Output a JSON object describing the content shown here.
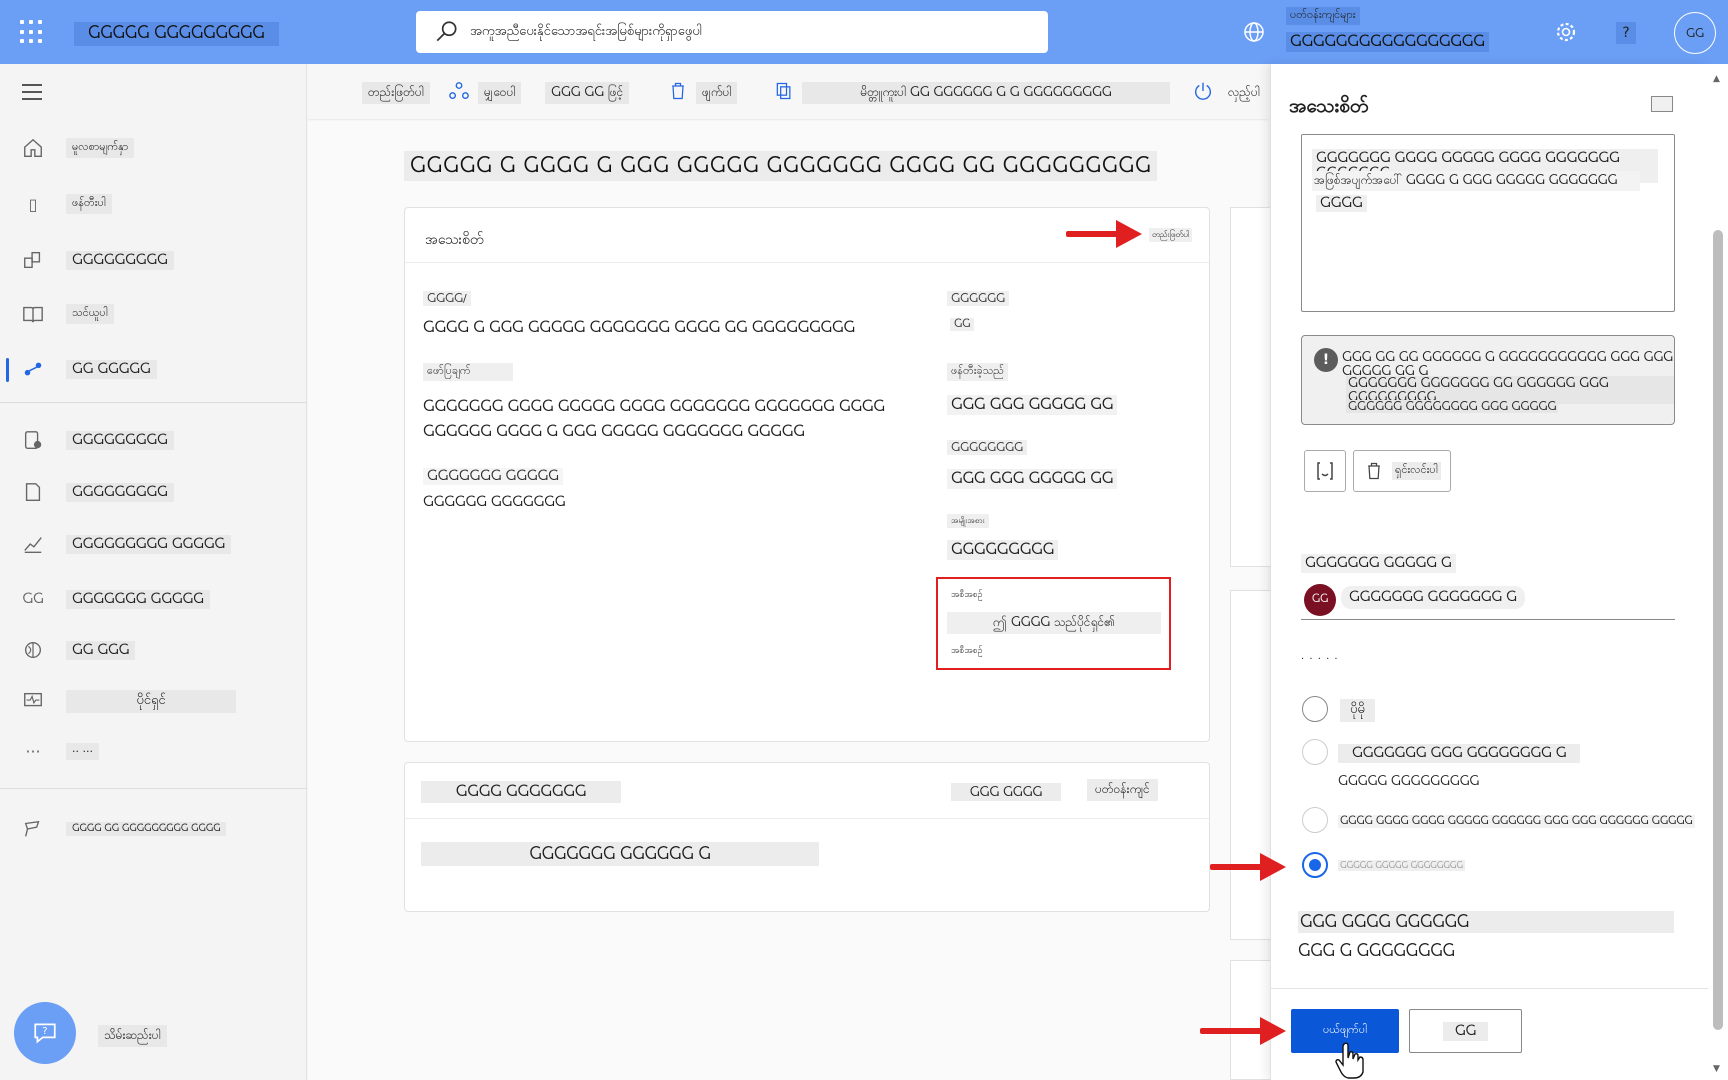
{
  "topbar": {
    "app_title": "ႺႺႺႺႺ ႺႺႺႺႺႺႺႺႺ",
    "search_placeholder": "အကူအညီပေးနိုင်သောအရင်းအမြစ်များကိုရှာဖွေပါ",
    "environment_label": "ပတ်ဝန်းကျင်များ",
    "environment_name": "ႺႺႺႺႺႺႺႺႺႺႺႺႺႺႺႺႺ",
    "help_label": "?",
    "avatar_initials": "ႺႺ"
  },
  "sidebar": {
    "items": [
      {
        "label": "မူလစာမျက်နှာ",
        "icon": "home-icon"
      },
      {
        "label": "ဖန်တီးပါ",
        "icon": "plus-icon"
      },
      {
        "label": "ႺႺႺႺႺႺႺႺႺ",
        "icon": "templates-icon"
      },
      {
        "label": "သင်ယူပါ",
        "icon": "book-icon"
      },
      {
        "label": "ႺႺ ႺႺႺႺႺ",
        "icon": "flow-icon"
      },
      {
        "label": "ႺႺႺႺႺႺႺႺႺ",
        "icon": "approvals-icon"
      },
      {
        "label": "ႺႺႺႺႺႺႺႺႺ",
        "icon": "solutions-icon"
      },
      {
        "label": "ႺႺႺႺႺႺႺႺႺ ႺႺႺႺႺ",
        "icon": "analytics-icon"
      },
      {
        "label": "ႺႺႺႺႺႺႺ ႺႺႺႺႺ",
        "icon": "process-icon"
      },
      {
        "label": "ႺႺ ႺႺႺ",
        "icon": "ai-icon"
      },
      {
        "label": "ပိုင်ရှင်",
        "icon": "monitor-icon"
      },
      {
        "label": "·· ···",
        "icon": "more-icon"
      },
      {
        "label": "ႺႺႺႺ ႺႺ ႺႺႺႺႺႺႺႺႺ ႺႺႺႺ",
        "icon": "power-platform-icon"
      }
    ],
    "help_text": "သိမ်းဆည်းပါ"
  },
  "commandbar": {
    "edit": "တည်းဖြတ်ပါ",
    "share": "မျှဝေပါ",
    "save_as": "ႺႺႺ ႺႺ ဖြင့်",
    "delete": "ဖျက်ပါ",
    "copy": "မိတ္တူကူးပါ ႺႺ ႺႺႺႺႺႺ Ⴚ Ⴚ ႺႺႺႺႺႺႺႺႺ",
    "turn_off": "လှည့်ပါ"
  },
  "page": {
    "title": "ႺႺႺႺႺ Ⴚ ႺႺႺႺ Ⴚ ႺႺႺ ႺႺႺႺႺ ႺႺႺႺႺႺႺ ႺႺႺႺ ႺႺ ႺႺႺႺႺႺႺႺႺ"
  },
  "details_card": {
    "title": "အသေးစိတ်",
    "edit_link": "တည်းဖြတ်ပါ",
    "flow_label": "ႺႺႺႺ/",
    "flow_value": "ႺႺႺႺ Ⴚ ႺႺႺ ႺႺႺႺႺ ႺႺႺႺႺႺႺ ႺႺႺႺ ႺႺ ႺႺႺႺႺႺႺႺႺ",
    "description_label": "ဖော်ပြချက်",
    "description_value": "ႺႺႺႺႺႺႺ ႺႺႺႺ ႺႺႺႺႺ ႺႺႺႺ ႺႺႺႺႺႺႺ ႺႺႺႺႺႺႺ ႺႺႺႺ ႺႺႺႺႺႺ ႺႺႺႺ Ⴚ ႺႺႺ ႺႺႺႺႺ ႺႺႺႺႺႺႺ ႺႺႺႺႺ",
    "plan_label": "ႺႺႺႺႺႺႺ ႺႺႺႺႺ",
    "plan_value": "ႺႺႺႺႺႺ ႺႺႺႺႺႺႺ",
    "status_label": "ႺႺႺႺႺႺ",
    "status_value": "ႺႺ",
    "created_label": "ဖန်တီးခဲ့သည်",
    "created_value": "ႺႺႺ ႺႺႺ ႺႺႺႺႺ ႺႺ",
    "modified_label": "ႺႺႺႺႺႺႺႺ",
    "modified_value": "ႺႺႺ ႺႺႺ ႺႺႺႺႺ ႺႺ",
    "type_label": "အမျိုးအစား",
    "type_value": "ႺႺႺႺႺႺႺႺႺ",
    "owner_label": "အစီအစဉ်",
    "owner_value": "ဤ ႺႺႺႺ သည်ပိုင်ရှင်၏",
    "owner_sub": "အစီအစဉ်"
  },
  "connections_card": {
    "title": "ႺႺႺႺ ႺႺႺႺႺႺႺ",
    "edit": "ႺႺႺ ႺႺႺႺ",
    "env": "ပတ်ဝန်းကျင်",
    "item": "ႺႺႺႺႺႺႺ ႺႺႺႺႺႺ Ⴚ"
  },
  "panel": {
    "title": "အသေးစိတ်",
    "textarea_line1": "ႺႺႺႺႺႺႺ ႺႺႺႺ ႺႺႺႺႺ ႺႺႺႺ ႺႺႺႺႺႺႺ ႺႺႺႺႺႺႺ",
    "textarea_line2": "အဖြစ်အပျက်အပေါ် ႺႺႺႺ Ⴚ ႺႺႺ ႺႺႺႺႺ ႺႺႺႺႺႺႺ",
    "textarea_line3": "ႺႺႺႺ",
    "warning_line1": "ႺႺႺ ႺႺ ႺႺ ႺႺႺႺႺႺ Ⴚ ႺႺႺႺႺႺႺႺႺႺႺ ႺႺႺ ႺႺႺ ႺႺႺႺႺ ႺႺ Ⴚ",
    "warning_line2": "ႺႺႺႺႺႺႺ ႺႺႺႺႺႺႺ ႺႺ ႺႺႺႺႺႺ ႺႺႺ ႺႺႺႺႺႺႺႺႺ",
    "warning_line3": "ႺႺႺႺႺႺ ႺႺႺႺႺႺႺႺ ႺႺႺ ႺႺႺႺႺ",
    "delete_button": "ရှင်းလင်းပါ",
    "owners_label": "ႺႺႺႺႺႺႺ ႺႺႺႺႺ Ⴚ",
    "owner_initials": "ႺႺ",
    "owner_name": "ႺႺႺႺႺႺႺ ႺႺႺႺႺႺႺ Ⴚ",
    "plan_heading": "· · · · ·",
    "options": [
      {
        "label": "ပိုမို",
        "selected": false
      },
      {
        "label": "ႺႺႺႺႺႺႺ ႺႺႺ ႺႺႺႺႺႺႺႺ Ⴚ",
        "sub": "ႺႺႺႺႺ ႺႺႺႺႺႺႺႺႺ",
        "selected": false
      },
      {
        "label": "ႺႺႺႺ ႺႺႺႺ ႺႺႺႺ ႺႺႺႺႺ ႺႺႺႺႺႺ ႺႺႺ ႺႺႺ ႺႺႺႺႺႺ ႺႺႺႺႺ",
        "selected": false
      },
      {
        "label": "ႺႺႺႺႺ ႺႺႺႺႺ ႺႺႺႺႺႺႺႺ",
        "selected": true
      }
    ],
    "footer_label": "ႺႺႺ ႺႺႺႺ ႺႺႺႺႺႺ",
    "footer_value": "ႺႺႺ Ⴚ ႺႺႺႺႺႺႺႺ",
    "save_button": "ပယ်ဖျက်ပါ",
    "cancel_button": "ႺႺ"
  },
  "colors": {
    "topbar": "#6b9ef5",
    "primary": "#0a57d8",
    "annotation": "#e02020"
  }
}
